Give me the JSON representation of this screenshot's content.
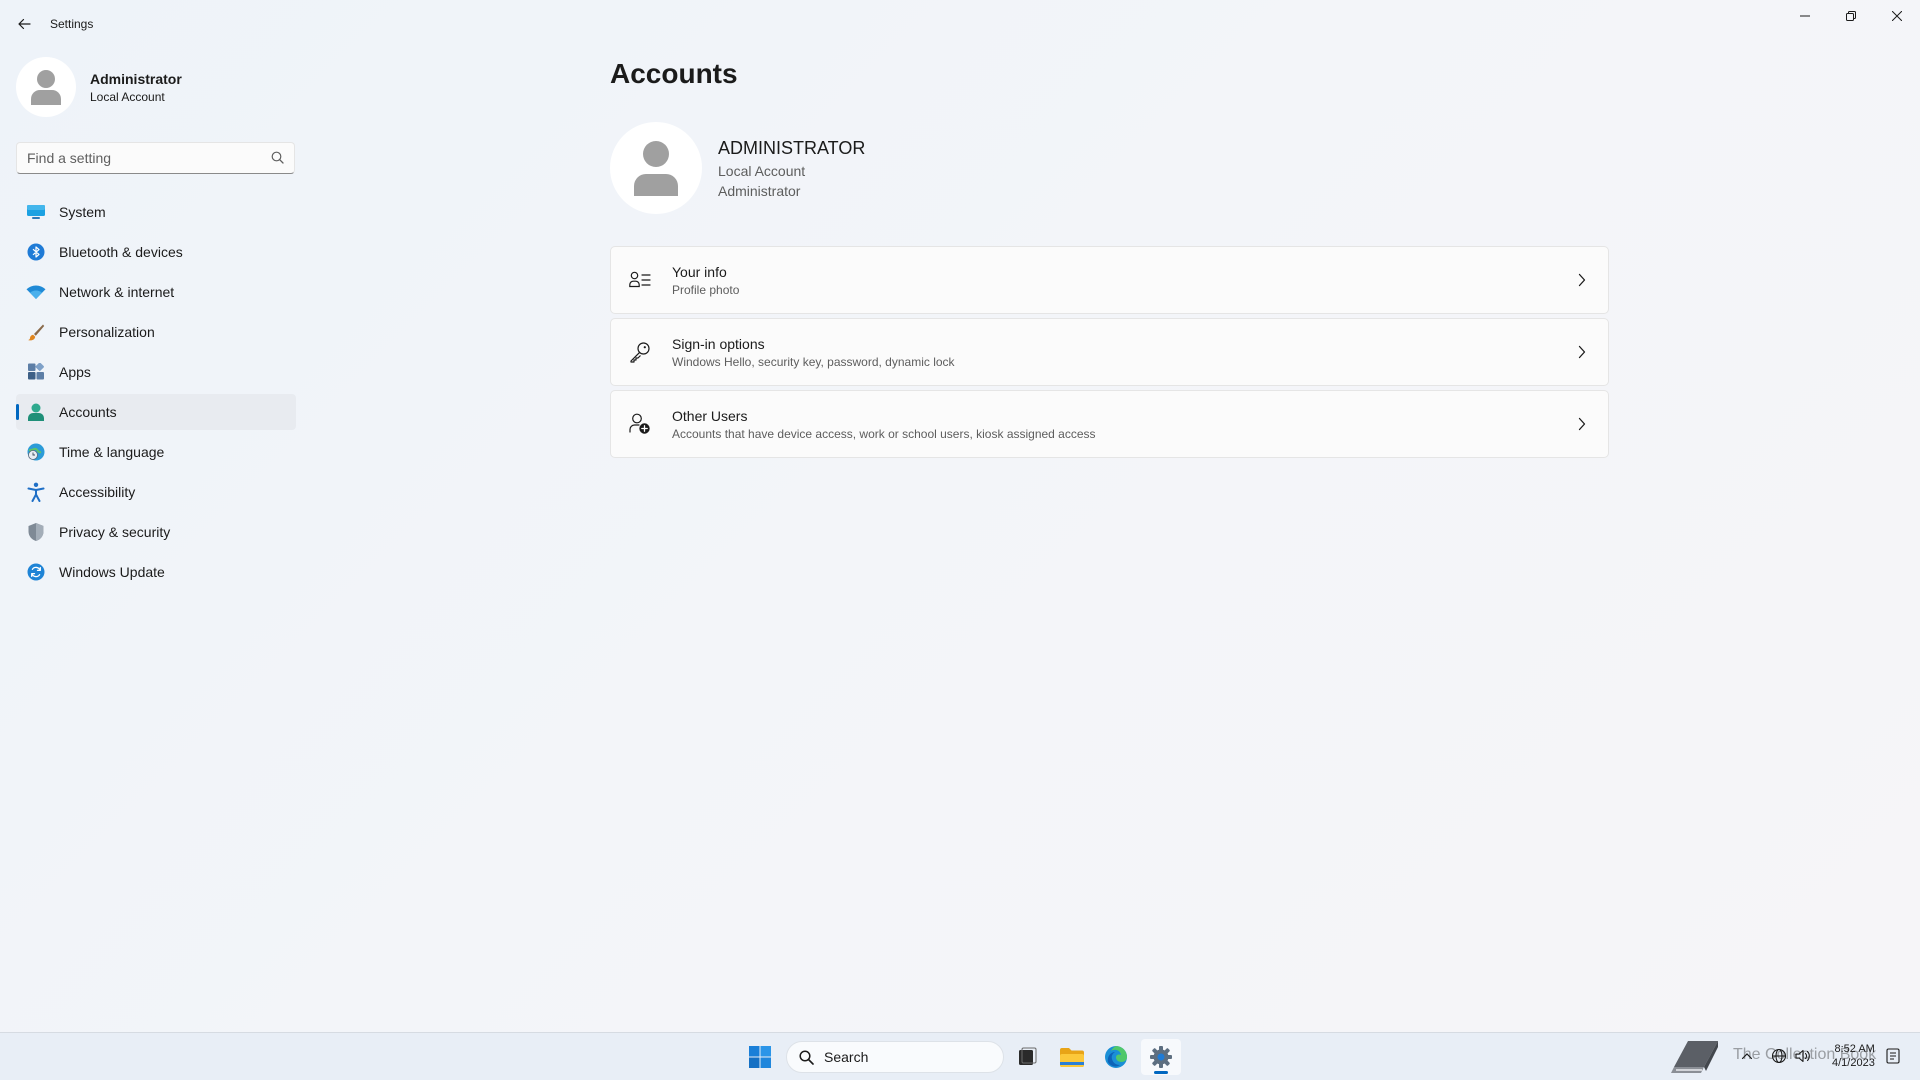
{
  "app": {
    "title": "Settings"
  },
  "profile": {
    "name": "Administrator",
    "account_type": "Local Account"
  },
  "search": {
    "placeholder": "Find a setting"
  },
  "nav": {
    "items": [
      {
        "label": "System",
        "icon": "monitor-icon"
      },
      {
        "label": "Bluetooth & devices",
        "icon": "bluetooth-icon"
      },
      {
        "label": "Network & internet",
        "icon": "wifi-icon"
      },
      {
        "label": "Personalization",
        "icon": "brush-icon"
      },
      {
        "label": "Apps",
        "icon": "apps-icon"
      },
      {
        "label": "Accounts",
        "icon": "person-icon",
        "active": true
      },
      {
        "label": "Time & language",
        "icon": "globe-clock-icon"
      },
      {
        "label": "Accessibility",
        "icon": "accessibility-icon"
      },
      {
        "label": "Privacy & security",
        "icon": "shield-icon"
      },
      {
        "label": "Windows Update",
        "icon": "update-icon"
      }
    ]
  },
  "main": {
    "title": "Accounts",
    "user": {
      "name": "ADMINISTRATOR",
      "account_type": "Local Account",
      "role": "Administrator"
    },
    "settings": [
      {
        "title": "Your info",
        "subtitle": "Profile photo",
        "icon": "person-list-icon"
      },
      {
        "title": "Sign-in options",
        "subtitle": "Windows Hello, security key, password, dynamic lock",
        "icon": "key-icon"
      },
      {
        "title": "Other Users",
        "subtitle": "Accounts that have device access, work or school users, kiosk assigned access",
        "icon": "person-add-icon"
      }
    ]
  },
  "taskbar": {
    "search_label": "Search",
    "watermark": "The Collection Book",
    "time": "8:52 AM",
    "date": "4/1/2023"
  },
  "colors": {
    "accent": "#0067c0",
    "background": "#f3f5f9",
    "card": "#fbfbfb"
  }
}
